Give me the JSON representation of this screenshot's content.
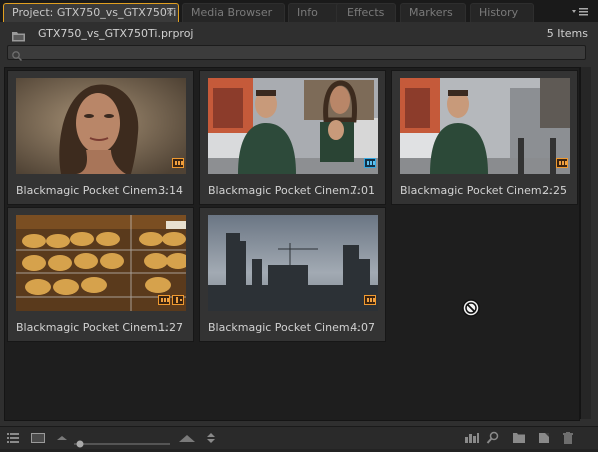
{
  "tabs": [
    {
      "label": "Project: GTX750_vs_GTX750Ti",
      "active": true,
      "close": "×"
    },
    {
      "label": "Media Browser"
    },
    {
      "label": "Info"
    },
    {
      "label": "Effects"
    },
    {
      "label": "Markers"
    },
    {
      "label": "History"
    }
  ],
  "panel_menu_icon": "panel-menu-icon",
  "project": {
    "filename": "GTX750_vs_GTX750Ti.prproj",
    "item_count": "5 Items",
    "search_placeholder": ""
  },
  "clips": [
    {
      "name": "Blackmagic Pocket Cinem...",
      "duration": "3:14",
      "badges": [
        "video"
      ]
    },
    {
      "name": "Blackmagic Pocket Cinem...",
      "duration": "7:01",
      "badges": [
        "sequence"
      ]
    },
    {
      "name": "Blackmagic Pocket Cinem...",
      "duration": "2:25",
      "badges": [
        "video"
      ]
    },
    {
      "name": "Blackmagic Pocket Cinem...",
      "duration": "1:27",
      "badges": [
        "video",
        "audio"
      ]
    },
    {
      "name": "Blackmagic Pocket Cinem...",
      "duration": "4:07",
      "badges": [
        "video"
      ]
    }
  ],
  "toolbar": {
    "left": [
      "list-view-icon",
      "icon-view-icon",
      "zoom-out-icon",
      "zoom-slider",
      "zoom-in-icon",
      "sort-icon"
    ],
    "right": [
      "automate-to-sequence-icon",
      "find-icon",
      "new-bin-icon",
      "new-item-icon",
      "trash-icon"
    ]
  },
  "colors": {
    "accent": "#e2a020",
    "panel": "#2f2f2f",
    "video_badge": "#f09a30",
    "sequence_badge": "#35a8e0"
  }
}
